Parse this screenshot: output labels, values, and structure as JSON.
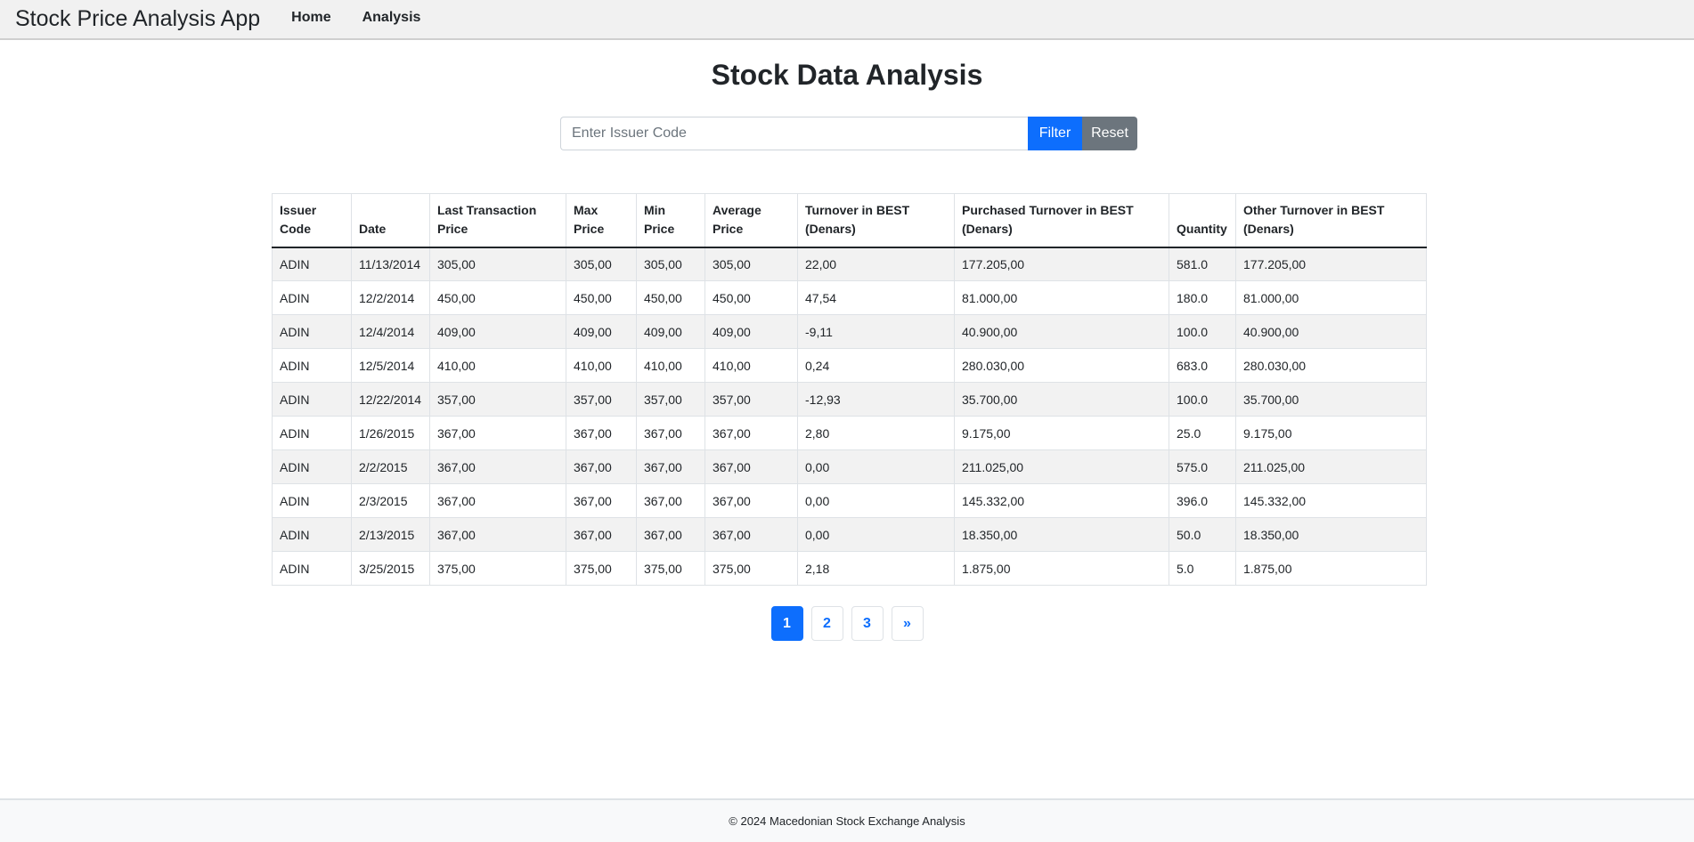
{
  "navbar": {
    "brand": "Stock Price Analysis App",
    "links": [
      {
        "label": "Home"
      },
      {
        "label": "Analysis"
      }
    ]
  },
  "page": {
    "title": "Stock Data Analysis"
  },
  "filter": {
    "placeholder": "Enter Issuer Code",
    "value": "",
    "filter_label": "Filter",
    "reset_label": "Reset"
  },
  "table": {
    "headers": [
      "Issuer Code",
      "Date",
      "Last Transaction Price",
      "Max Price",
      "Min Price",
      "Average Price",
      "Turnover in BEST (Denars)",
      "Purchased Turnover in BEST (Denars)",
      "Quantity",
      "Other Turnover in BEST (Denars)"
    ],
    "rows": [
      [
        "ADIN",
        "11/13/2014",
        "305,00",
        "305,00",
        "305,00",
        "305,00",
        "22,00",
        "177.205,00",
        "581.0",
        "177.205,00"
      ],
      [
        "ADIN",
        "12/2/2014",
        "450,00",
        "450,00",
        "450,00",
        "450,00",
        "47,54",
        "81.000,00",
        "180.0",
        "81.000,00"
      ],
      [
        "ADIN",
        "12/4/2014",
        "409,00",
        "409,00",
        "409,00",
        "409,00",
        "-9,11",
        "40.900,00",
        "100.0",
        "40.900,00"
      ],
      [
        "ADIN",
        "12/5/2014",
        "410,00",
        "410,00",
        "410,00",
        "410,00",
        "0,24",
        "280.030,00",
        "683.0",
        "280.030,00"
      ],
      [
        "ADIN",
        "12/22/2014",
        "357,00",
        "357,00",
        "357,00",
        "357,00",
        "-12,93",
        "35.700,00",
        "100.0",
        "35.700,00"
      ],
      [
        "ADIN",
        "1/26/2015",
        "367,00",
        "367,00",
        "367,00",
        "367,00",
        "2,80",
        "9.175,00",
        "25.0",
        "9.175,00"
      ],
      [
        "ADIN",
        "2/2/2015",
        "367,00",
        "367,00",
        "367,00",
        "367,00",
        "0,00",
        "211.025,00",
        "575.0",
        "211.025,00"
      ],
      [
        "ADIN",
        "2/3/2015",
        "367,00",
        "367,00",
        "367,00",
        "367,00",
        "0,00",
        "145.332,00",
        "396.0",
        "145.332,00"
      ],
      [
        "ADIN",
        "2/13/2015",
        "367,00",
        "367,00",
        "367,00",
        "367,00",
        "0,00",
        "18.350,00",
        "50.0",
        "18.350,00"
      ],
      [
        "ADIN",
        "3/25/2015",
        "375,00",
        "375,00",
        "375,00",
        "375,00",
        "2,18",
        "1.875,00",
        "5.0",
        "1.875,00"
      ]
    ]
  },
  "pagination": {
    "pages": [
      "1",
      "2",
      "3"
    ],
    "current": "1",
    "next_label": "»"
  },
  "footer": {
    "text": "© 2024 Macedonian Stock Exchange Analysis"
  },
  "colors": {
    "primary": "#0d6efd",
    "secondary": "#6c757d",
    "navbar_bg": "#f1f1f1",
    "striped_row": "#f2f2f2"
  }
}
